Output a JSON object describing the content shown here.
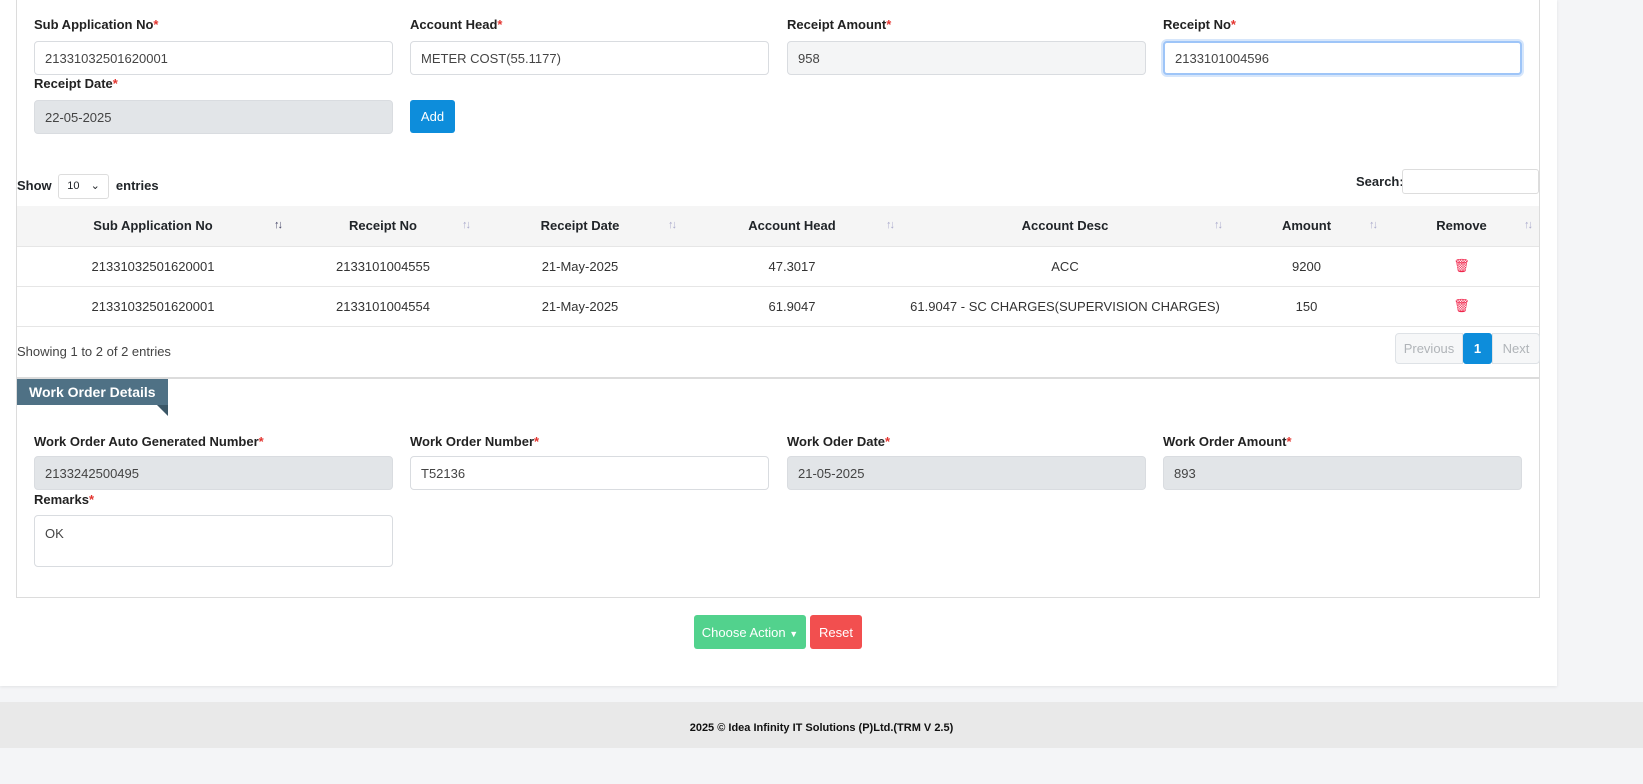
{
  "form": {
    "sub_app_label": "Sub Application No",
    "sub_app_value": "21331032501620001",
    "account_head_label": "Account Head",
    "account_head_value": "METER COST(55.1177)",
    "receipt_amount_label": "Receipt Amount",
    "receipt_amount_value": "958",
    "receipt_no_label": "Receipt No",
    "receipt_no_value": "2133101004596",
    "receipt_date_label": "Receipt Date",
    "receipt_date_value": "22-05-2025",
    "required_mark": "*",
    "add_label": "Add"
  },
  "table": {
    "show_label": "Show",
    "entries_label": "entries",
    "page_size": "10",
    "search_label": "Search:",
    "search_value": "",
    "columns": [
      "Sub Application No",
      "Receipt No",
      "Receipt Date",
      "Account Head",
      "Account Desc",
      "Amount",
      "Remove"
    ],
    "rows": [
      [
        "21331032501620001",
        "2133101004555",
        "21-May-2025",
        "47.3017",
        "ACC",
        "9200"
      ],
      [
        "21331032501620001",
        "2133101004554",
        "21-May-2025",
        "61.9047",
        "61.9047 - SC CHARGES(SUPERVISION CHARGES)",
        "150"
      ]
    ],
    "info": "Showing 1 to 2 of 2 entries",
    "pagination": {
      "previous": "Previous",
      "current": "1",
      "next": "Next"
    },
    "remove_icon": "trash-icon"
  },
  "work_order": {
    "title": "Work Order Details",
    "auto_no_label": "Work Order Auto Generated Number",
    "auto_no_value": "2133242500495",
    "number_label": "Work Order Number",
    "number_value": "T52136",
    "date_label": "Work Oder Date",
    "date_value": "21-05-2025",
    "amount_label": "Work Order Amount",
    "amount_value": "893",
    "remarks_label": "Remarks",
    "remarks_value": "OK"
  },
  "actions": {
    "choose_action": "Choose Action",
    "reset": "Reset"
  },
  "footer": {
    "text": "2025 © Idea Infinity IT Solutions (P)Ltd.(TRM V 2.5)"
  },
  "colors": {
    "primary": "#0d8ddb",
    "success": "#52d28d",
    "danger": "#f24f4f",
    "section_tab": "#4f7185"
  }
}
